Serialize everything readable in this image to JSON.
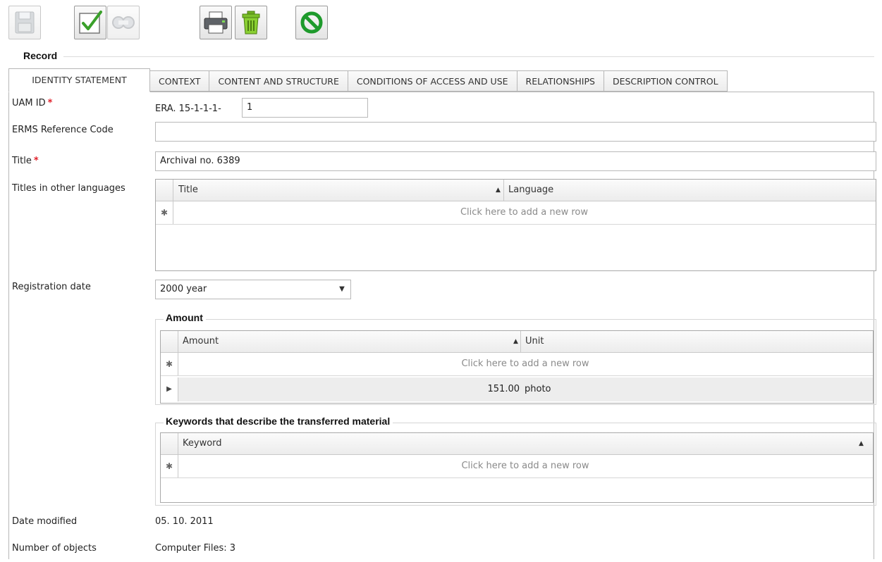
{
  "toolbar": {
    "buttons": [
      {
        "name": "save-icon",
        "enabled": false
      },
      {
        "name": "checkmark-icon",
        "enabled": true
      },
      {
        "name": "link-icon",
        "enabled": false
      },
      {
        "name": "print-icon",
        "enabled": true
      },
      {
        "name": "trash-icon",
        "enabled": true
      },
      {
        "name": "cancel-icon",
        "enabled": true
      }
    ]
  },
  "group_title": "Record",
  "tabs": [
    {
      "label": "IDENTITY STATEMENT",
      "active": true
    },
    {
      "label": "CONTEXT"
    },
    {
      "label": "CONTENT AND STRUCTURE"
    },
    {
      "label": "CONDITIONS OF ACCESS AND USE"
    },
    {
      "label": "RELATIONSHIPS"
    },
    {
      "label": "DESCRIPTION CONTROL"
    }
  ],
  "form": {
    "uam_id": {
      "label": "UAM ID",
      "required_mark": "*",
      "prefix": "ERA. 15-1-1-1-",
      "value": "1"
    },
    "erms_ref": {
      "label": "ERMS Reference Code",
      "value": ""
    },
    "title": {
      "label": "Title",
      "required_mark": "*",
      "value": "Archival no. 6389"
    },
    "titles_other": {
      "label": "Titles in other languages",
      "columns": [
        "Title",
        "Language"
      ],
      "add_row_text": "Click here to add a new row"
    },
    "registration_date": {
      "label": "Registration date",
      "value": "2000 year"
    },
    "amount": {
      "legend": "Amount",
      "columns": [
        "Amount",
        "Unit"
      ],
      "add_row_text": "Click here to add a new row",
      "rows": [
        {
          "amount": "151.00",
          "unit": "photo"
        }
      ]
    },
    "keywords": {
      "legend": "Keywords that describe the transferred material",
      "columns": [
        "Keyword"
      ],
      "add_row_text": "Click here to add a new row"
    },
    "date_modified": {
      "label": "Date modified",
      "value": "05. 10. 2011"
    },
    "number_of_objects": {
      "label": "Number of objects",
      "value": "Computer Files: 3"
    }
  }
}
